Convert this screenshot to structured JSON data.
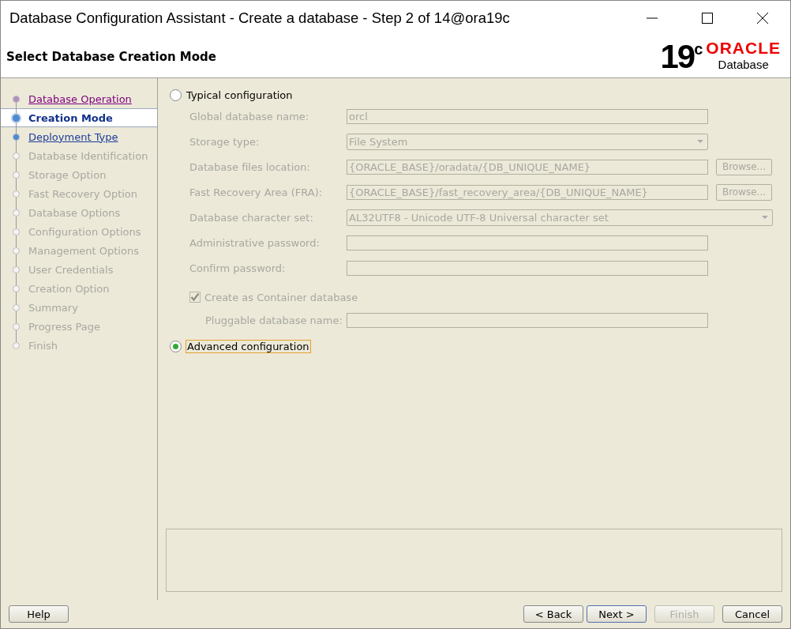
{
  "window": {
    "title": "Database Configuration Assistant - Create a database - Step 2 of 14@ora19c"
  },
  "header": {
    "title": "Select Database Creation Mode",
    "logo": {
      "version": "19",
      "suffix": "c",
      "brand": "ORACLE",
      "product": "Database"
    }
  },
  "steps": [
    {
      "label": "Database Operation",
      "kind": "visited",
      "selected": false
    },
    {
      "label": "Creation Mode",
      "kind": "current",
      "selected": true
    },
    {
      "label": "Deployment Type",
      "kind": "link",
      "selected": false
    },
    {
      "label": "Database Identification",
      "kind": "pending",
      "selected": false
    },
    {
      "label": "Storage Option",
      "kind": "pending",
      "selected": false
    },
    {
      "label": "Fast Recovery Option",
      "kind": "pending",
      "selected": false
    },
    {
      "label": "Database Options",
      "kind": "pending",
      "selected": false
    },
    {
      "label": "Configuration Options",
      "kind": "pending",
      "selected": false
    },
    {
      "label": "Management Options",
      "kind": "pending",
      "selected": false
    },
    {
      "label": "User Credentials",
      "kind": "pending",
      "selected": false
    },
    {
      "label": "Creation Option",
      "kind": "pending",
      "selected": false
    },
    {
      "label": "Summary",
      "kind": "pending",
      "selected": false
    },
    {
      "label": "Progress Page",
      "kind": "pending",
      "selected": false
    },
    {
      "label": "Finish",
      "kind": "pending",
      "selected": false
    }
  ],
  "typical": {
    "label": "Typical configuration",
    "selected": false,
    "fields": [
      {
        "label": "Global database name:",
        "kind": "text",
        "value": "orcl"
      },
      {
        "label": "Storage type:",
        "kind": "select",
        "value": "File System"
      },
      {
        "label": "Database files location:",
        "kind": "text",
        "value": "{ORACLE_BASE}/oradata/{DB_UNIQUE_NAME}",
        "button": "Browse..."
      },
      {
        "label": "Fast Recovery Area (FRA):",
        "kind": "text",
        "value": "{ORACLE_BASE}/fast_recovery_area/{DB_UNIQUE_NAME}",
        "button": "Browse..."
      },
      {
        "label": "Database character set:",
        "kind": "wideselect",
        "value": "AL32UTF8 - Unicode UTF-8 Universal character set"
      },
      {
        "label": "Administrative password:",
        "kind": "text"
      },
      {
        "label": "Confirm password:",
        "kind": "text"
      }
    ],
    "container": {
      "label": "Create as Container database",
      "checked": true
    },
    "pluggable": {
      "label": "Pluggable database name:"
    }
  },
  "advanced": {
    "label": "Advanced configuration",
    "selected": true
  },
  "buttons": {
    "help": "Help",
    "back": "< Back",
    "next": "Next >",
    "finish": "Finish",
    "cancel": "Cancel"
  }
}
